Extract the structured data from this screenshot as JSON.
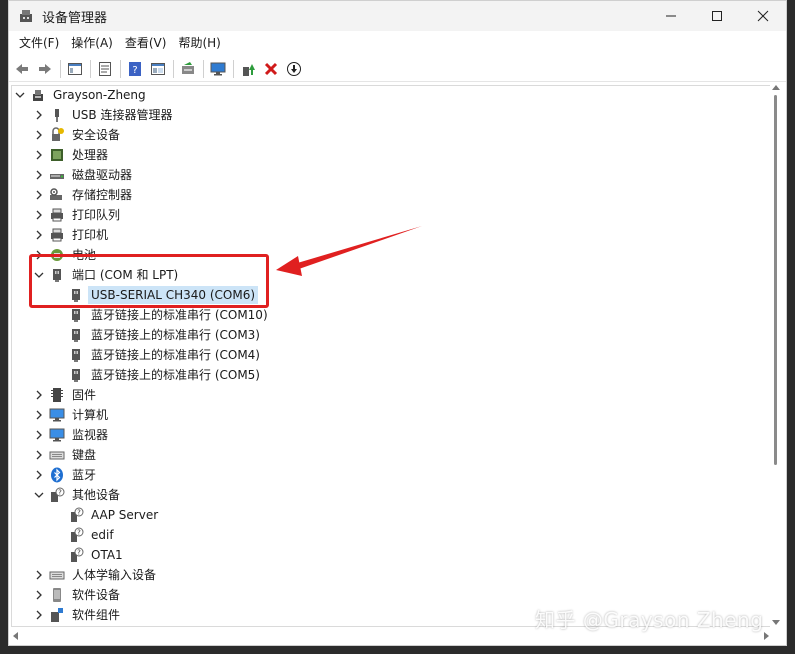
{
  "window": {
    "title": "设备管理器"
  },
  "menu": [
    "文件(F)",
    "操作(A)",
    "查看(V)",
    "帮助(H)"
  ],
  "toolbar": {
    "buttons": [
      "back-icon",
      "forward-icon",
      "properties-icon",
      "console-tree-icon",
      "help-icon",
      "view-icon",
      "scan-hardware-icon",
      "monitor-icon",
      "update-driver-icon",
      "uninstall-icon",
      "download-icon"
    ]
  },
  "tree": {
    "root": "Grayson-Zheng",
    "categories": {
      "usb": "USB 连接器管理器",
      "security": "安全设备",
      "cpu": "处理器",
      "disk": "磁盘驱动器",
      "storage": "存储控制器",
      "printqueue": "打印队列",
      "printer": "打印机",
      "battery": "电池",
      "ports": "端口 (COM 和 LPT)",
      "firmware": "固件",
      "computer": "计算机",
      "monitor": "监视器",
      "keyboard": "键盘",
      "bluetooth": "蓝牙",
      "other": "其他设备",
      "hid": "人体学输入设备",
      "software_dev": "软件设备",
      "software_comp": "软件组件"
    },
    "ports_children": [
      "USB-SERIAL CH340 (COM6)",
      "蓝牙链接上的标准串行 (COM10)",
      "蓝牙链接上的标准串行 (COM3)",
      "蓝牙链接上的标准串行 (COM4)",
      "蓝牙链接上的标准串行 (COM5)"
    ],
    "other_children": [
      "AAP Server",
      "edif",
      "OTA1"
    ]
  },
  "annotation": {
    "box_color": "#e02020"
  },
  "watermark": "知乎 @Grayson Zheng"
}
